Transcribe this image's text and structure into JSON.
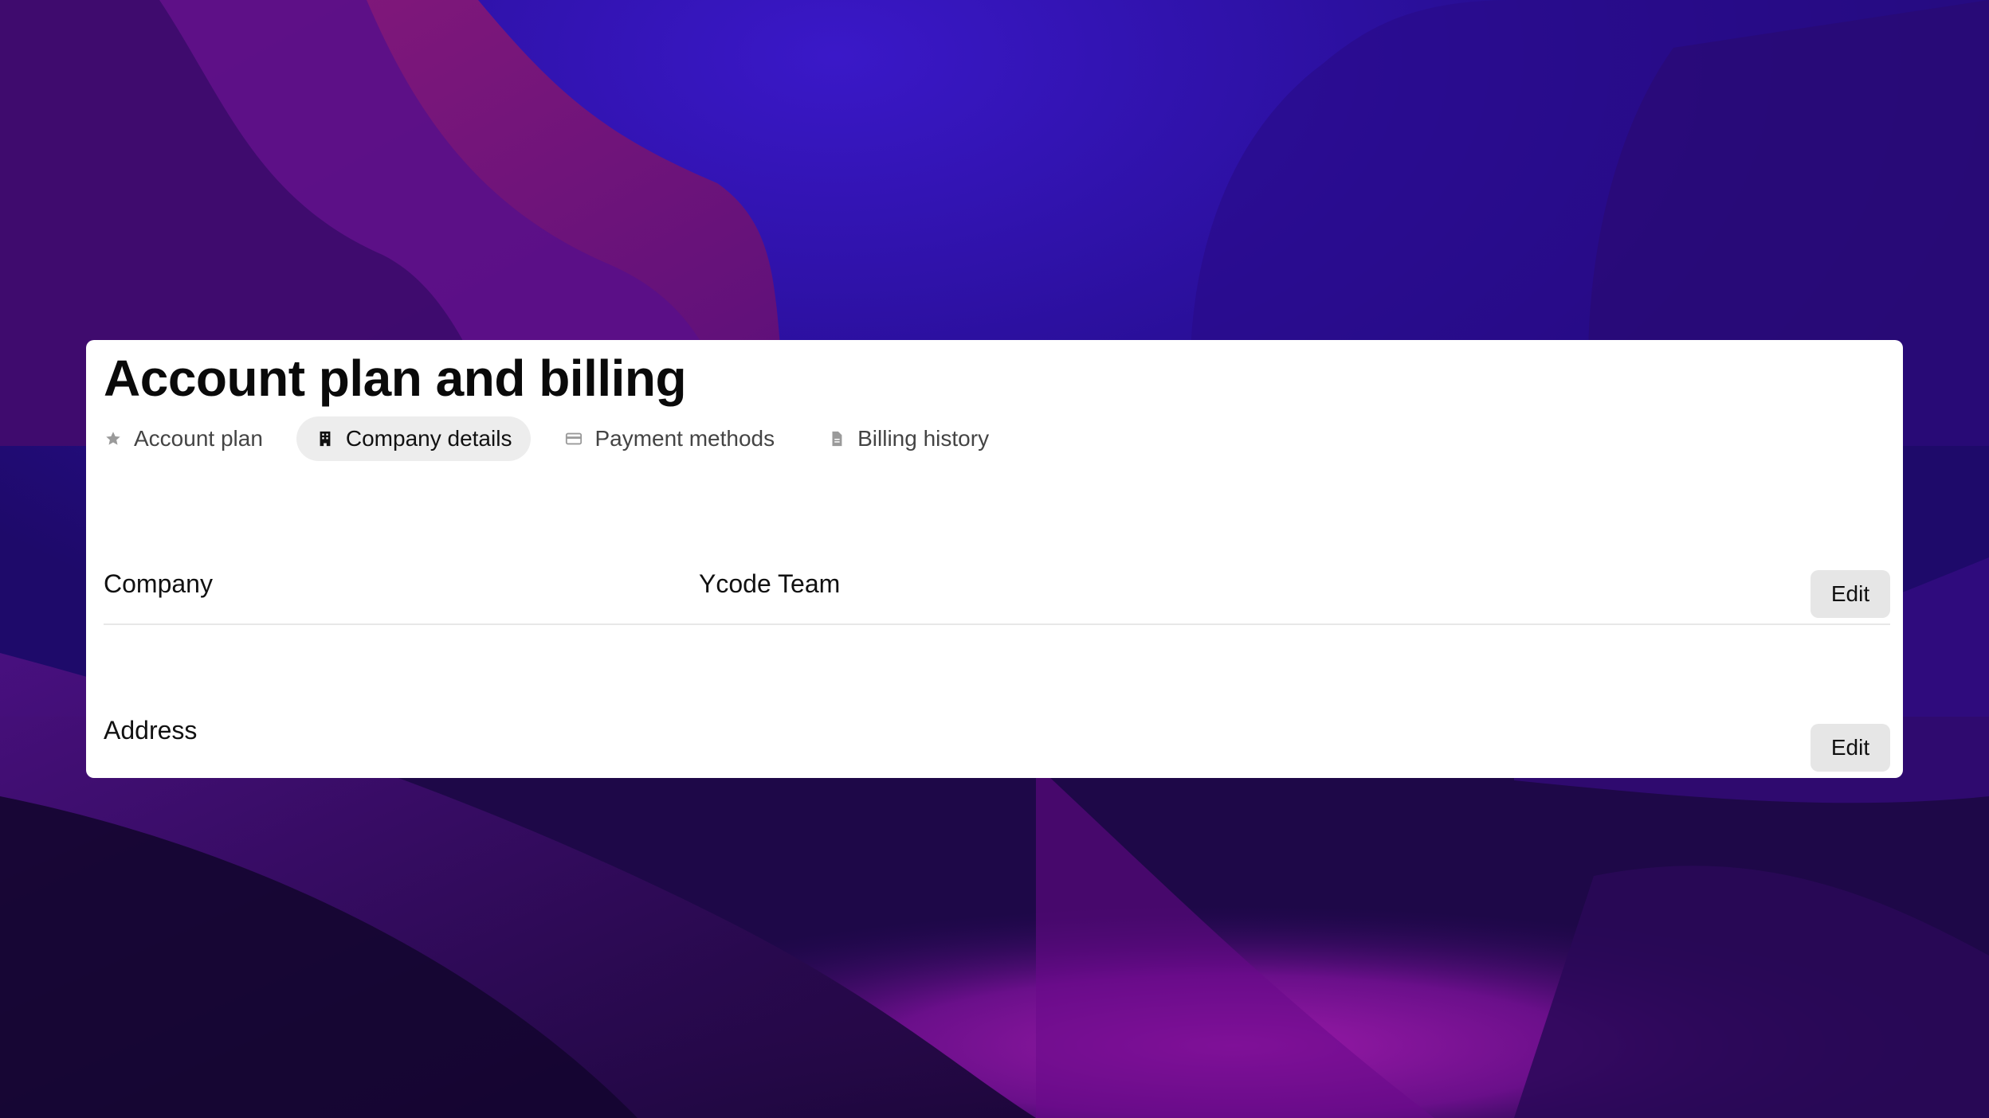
{
  "page": {
    "title": "Account plan and billing"
  },
  "tabs": [
    {
      "label": "Account plan",
      "icon": "star-icon",
      "active": false
    },
    {
      "label": "Company details",
      "icon": "building-icon",
      "active": true
    },
    {
      "label": "Payment methods",
      "icon": "credit-card-icon",
      "active": false
    },
    {
      "label": "Billing history",
      "icon": "document-icon",
      "active": false
    }
  ],
  "company_details": {
    "rows": [
      {
        "label": "Company",
        "value": "Ycode Team",
        "edit_label": "Edit"
      },
      {
        "label": "Address",
        "value": "",
        "edit_label": "Edit"
      }
    ]
  },
  "colors": {
    "panel_background": "#ffffff",
    "active_tab_background": "#ededed",
    "edit_button_background": "#e6e6e6",
    "divider": "#e8e8e8"
  }
}
